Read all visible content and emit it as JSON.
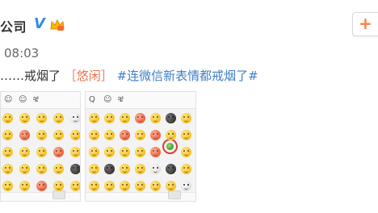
{
  "header": {
    "account_name": "公司",
    "verified_mark": "V",
    "time": "08:03",
    "follow_icon": "plus-icon"
  },
  "post": {
    "text_prefix": "……戒烟了",
    "tag": "［悠闲］",
    "topic": "#连微信新表情都戒烟了#"
  },
  "panels": {
    "left_toolbar": [
      "☺",
      "☺",
      "ቼ"
    ],
    "right_toolbar": [
      "Q",
      "☺",
      "ቼ"
    ],
    "accent_color": "#e23a3a"
  }
}
